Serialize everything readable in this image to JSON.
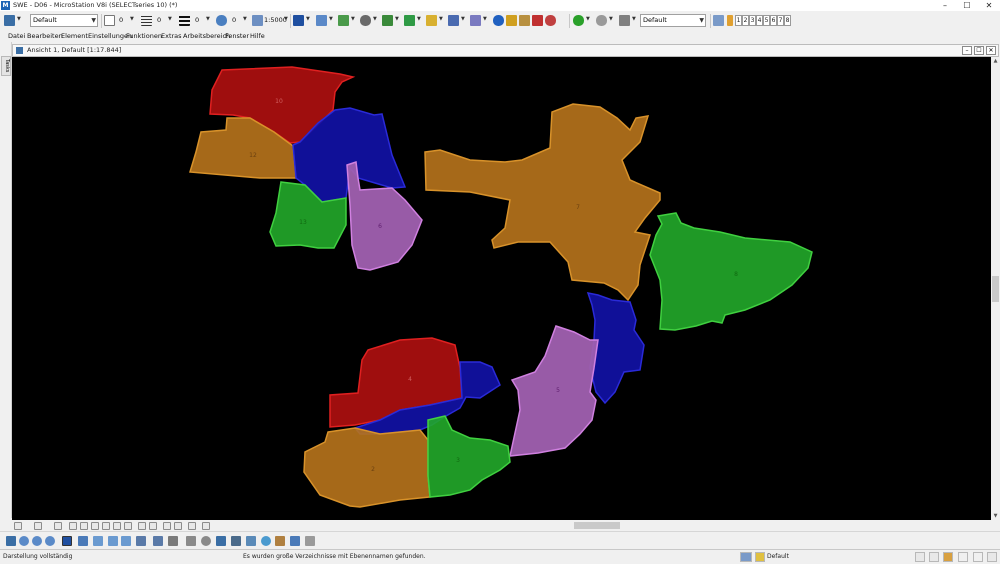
{
  "window": {
    "title": "SWE - D06 - MicroStation V8i (SELECTseries 10) (*)",
    "app_icon_label": "M",
    "minimize": "–",
    "maximize": "☐",
    "close": "✕"
  },
  "toolbar": {
    "level_combo": "Default",
    "color_value": "0",
    "style_value": "0",
    "weight_value": "0",
    "transparency_value": "0",
    "scale_value": "1:5000",
    "view_level_combo": "Default",
    "view_buttons": [
      "1",
      "2",
      "3",
      "4",
      "5",
      "6",
      "7",
      "8"
    ]
  },
  "menu": {
    "items": [
      "Datei",
      "Bearbeiten",
      "Element",
      "Einstellungen",
      "Funktionen",
      "Extras",
      "Arbeitsbereich",
      "Fenster",
      "Hilfe"
    ]
  },
  "view": {
    "title": "Ansicht 1, Default [1:17.844]",
    "left_tab": "Tasks"
  },
  "map": {
    "labels": [
      "10",
      "12",
      "13",
      "6",
      "7",
      "8",
      "4",
      "2",
      "3",
      "5"
    ]
  },
  "status": {
    "left": "Darstellung vollständig",
    "message": "Es wurden große Verzeichnisse mit Ebenennamen gefunden.",
    "level": "Default"
  },
  "colors": {
    "red": "#b01010",
    "orange": "#b8741c",
    "blue": "#1212a8",
    "green": "#22aa2a",
    "violet": "#a060b0"
  }
}
